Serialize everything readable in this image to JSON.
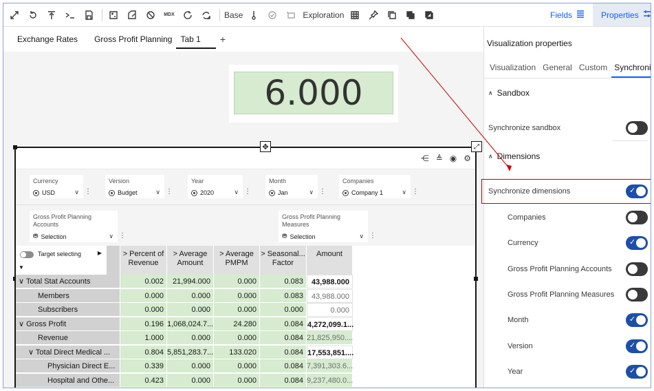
{
  "toolbar": {
    "base_label": "Base",
    "exploration_label": "Exploration",
    "fields_label": "Fields",
    "properties_label": "Properties",
    "mdx_label": "MDX",
    "icons": [
      "expand-icon",
      "undo-icon",
      "upload-icon",
      "console-icon",
      "save-icon",
      "calc-icon",
      "export-icon",
      "null-icon",
      "refresh-icon",
      "refresh-alt-icon",
      "thermometer-icon",
      "check-circle-icon",
      "rectangle-icon",
      "grid-icon",
      "pin-icon",
      "copy-icon",
      "duplicate-icon",
      "window-icon"
    ]
  },
  "tabs": [
    "Exchange Rates",
    "Gross Profit Planning",
    "Tab 1"
  ],
  "tab_plus": "+",
  "kpi": {
    "value": "6.000"
  },
  "filters": [
    {
      "label": "Currency",
      "value": "USD"
    },
    {
      "label": "Version",
      "value": "Budget"
    },
    {
      "label": "Year",
      "value": "2020"
    },
    {
      "label": "Month",
      "value": "Jan"
    },
    {
      "label": "Companies",
      "value": "Company 1"
    }
  ],
  "filters2": [
    {
      "label_line1": "Gross Profit Planning",
      "label_line2": "Accounts",
      "value": "Selection"
    },
    {
      "label_line1": "Gross Profit Planning",
      "label_line2": "Measures",
      "value": "Selection"
    }
  ],
  "grid": {
    "target_selecting": "Target selecting",
    "columns": [
      {
        "line1": "> Percent of",
        "line2": "Revenue"
      },
      {
        "line1": "> Average",
        "line2": "Amount"
      },
      {
        "line1": "> Average",
        "line2": "PMPM"
      },
      {
        "line1": "> Seasonal...",
        "line2": "Factor"
      },
      {
        "line1": "Amount",
        "line2": ""
      }
    ],
    "rows": [
      {
        "label": "Total Stat Accounts",
        "prefix": "∨",
        "indent": 0,
        "bold": false,
        "values": [
          "0.002",
          "21,994.000",
          "0.000",
          "0.083",
          "43,988.000"
        ],
        "amount_style": "white-bold"
      },
      {
        "label": "Members",
        "prefix": "",
        "indent": 1,
        "bold": false,
        "values": [
          "0.000",
          "0.000",
          "0.000",
          "0.083",
          "43,988.000"
        ],
        "amount_style": "white"
      },
      {
        "label": "Subscribers",
        "prefix": "",
        "indent": 1,
        "bold": false,
        "values": [
          "0.000",
          "0.000",
          "0.000",
          "0.000",
          "0.000"
        ],
        "amount_style": "white"
      },
      {
        "label": "Gross Profit",
        "prefix": "∨",
        "indent": 0,
        "bold": false,
        "values": [
          "0.196",
          "1,068,024.7...",
          "24.280",
          "0.084",
          "4,272,099.1..."
        ],
        "amount_style": "white-bold"
      },
      {
        "label": "Revenue",
        "prefix": "",
        "indent": 1,
        "bold": false,
        "values": [
          "1.000",
          "0.000",
          "0.000",
          "0.084",
          "21,825,950...."
        ],
        "amount_style": "green"
      },
      {
        "label": "Total Direct Medical ...",
        "prefix": "∨",
        "indent": 1,
        "bold": false,
        "values": [
          "0.804",
          "5,851,283.7...",
          "133.020",
          "0.084",
          "17,553,851...."
        ],
        "amount_style": "white-bold"
      },
      {
        "label": "Physician Direct E...",
        "prefix": "",
        "indent": 2,
        "bold": false,
        "values": [
          "0.339",
          "0.000",
          "0.000",
          "0.084",
          "7,391,303.6..."
        ],
        "amount_style": "green"
      },
      {
        "label": "Hospital and Othe...",
        "prefix": "",
        "indent": 2,
        "bold": false,
        "values": [
          "0.423",
          "0.000",
          "0.000",
          "0.084",
          "9,237,480.0..."
        ],
        "amount_style": "green"
      }
    ]
  },
  "panel": {
    "title": "Visualization properties",
    "tabs": [
      "Visualization",
      "General",
      "Custom",
      "Synchronize"
    ],
    "sandbox_header": "Sandbox",
    "sync_sandbox_label": "Synchronize sandbox",
    "dimensions_header": "Dimensions",
    "sync_dimensions_label": "Synchronize dimensions",
    "dimension_items": [
      {
        "label": "Companies",
        "on": false
      },
      {
        "label": "Currency",
        "on": true
      },
      {
        "label": "Gross Profit Planning Accounts",
        "on": false
      },
      {
        "label": "Gross Profit Planning Measures",
        "on": false
      },
      {
        "label": "Month",
        "on": true
      },
      {
        "label": "Version",
        "on": true
      },
      {
        "label": "Year",
        "on": true
      }
    ],
    "sync_sandbox_on": false,
    "sync_dimensions_on": true
  },
  "colors": {
    "accent": "#0f62fe",
    "highlight": "#c00000",
    "cell_green": "#d6ebcf"
  }
}
